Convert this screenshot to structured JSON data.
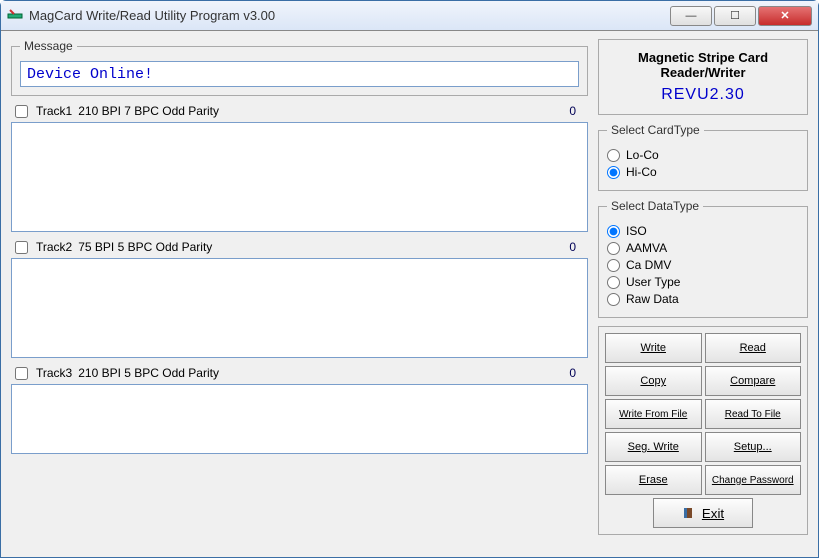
{
  "window": {
    "title": "MagCard Write/Read Utility Program v3.00"
  },
  "message": {
    "legend": "Message",
    "value": "Device Online!"
  },
  "tracks": [
    {
      "checkLabel": "Track1",
      "spec": "210 BPI  7 BPC  Odd Parity",
      "count": "0"
    },
    {
      "checkLabel": "Track2",
      "spec": "75 BPI  5 BPC  Odd Parity",
      "count": "0"
    },
    {
      "checkLabel": "Track3",
      "spec": "210 BPI  5 BPC  Odd Parity",
      "count": "0"
    }
  ],
  "brand": {
    "title": "Magnetic Stripe Card Reader/Writer",
    "version": "REVU2.30"
  },
  "cardType": {
    "legend": "Select CardType",
    "options": [
      {
        "label": "Lo-Co",
        "checked": false
      },
      {
        "label": "Hi-Co",
        "checked": true
      }
    ]
  },
  "dataType": {
    "legend": "Select DataType",
    "options": [
      {
        "label": "ISO",
        "checked": true
      },
      {
        "label": "AAMVA",
        "checked": false
      },
      {
        "label": "Ca DMV",
        "checked": false
      },
      {
        "label": "User Type",
        "checked": false
      },
      {
        "label": "Raw Data",
        "checked": false
      }
    ]
  },
  "buttons": {
    "write": "Write",
    "read": "Read",
    "copy": "Copy",
    "compare": "Compare",
    "writeFromFile": "Write From File",
    "readToFile": "Read To File",
    "segWrite": "Seg. Write",
    "setup": "Setup...",
    "erase": "Erase",
    "changePassword": "Change Password",
    "exit": "Exit"
  }
}
